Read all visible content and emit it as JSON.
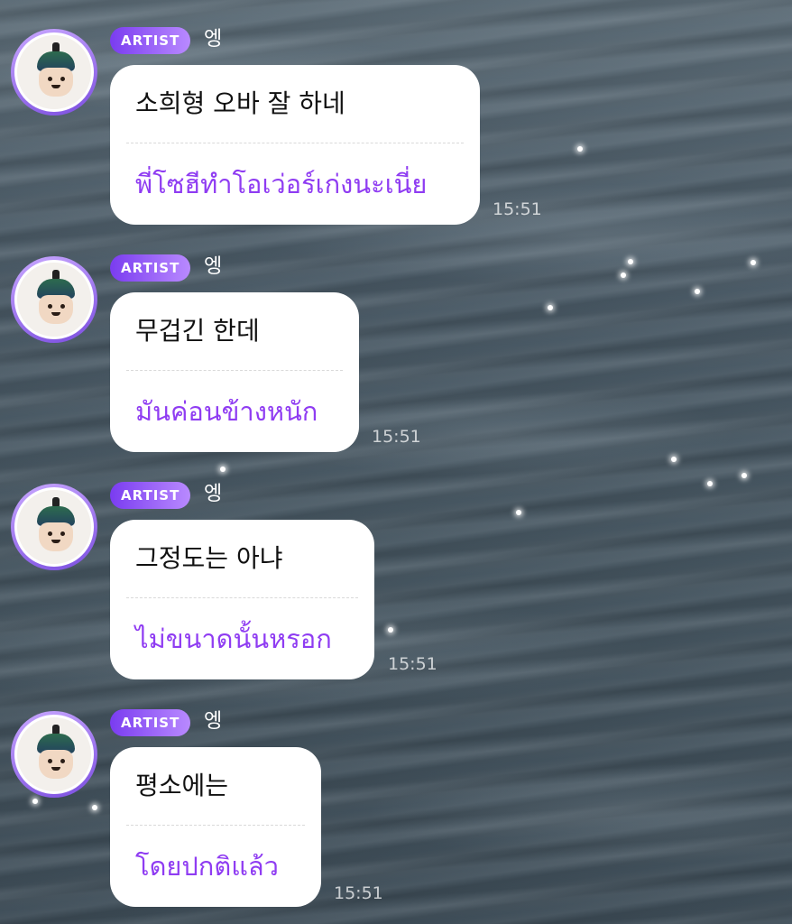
{
  "messages": [
    {
      "badge": "ARTIST",
      "sender": "엥",
      "korean": "소희형 오바 잘 하네",
      "thai": "พี่โซฮีทำโอเว่อร์เก่งนะเนี่ย",
      "time": "15:51"
    },
    {
      "badge": "ARTIST",
      "sender": "엥",
      "korean": "무겁긴 한데",
      "thai": "มันค่อนข้างหนัก",
      "time": "15:51"
    },
    {
      "badge": "ARTIST",
      "sender": "엥",
      "korean": "그정도는 아냐",
      "thai": "ไม่ขนาดนั้นหรอก",
      "time": "15:51"
    },
    {
      "badge": "ARTIST",
      "sender": "엥",
      "korean": "평소에는",
      "thai": "โดยปกติแล้ว",
      "time": "15:51"
    }
  ],
  "icons": {
    "avatar": "mushroom-character-avatar"
  },
  "colors": {
    "badge_start": "#7a3cf0",
    "badge_end": "#b98aff",
    "translation_text": "#8f3cf2",
    "bubble": "#ffffff"
  }
}
